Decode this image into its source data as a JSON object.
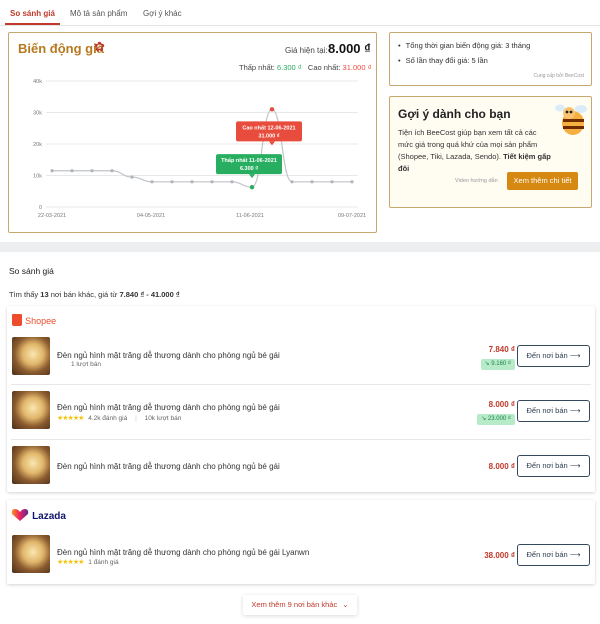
{
  "tabs": [
    {
      "label": "So sánh giá"
    },
    {
      "label": "Mô tả sản phẩm"
    },
    {
      "label": "Gợi ý khác"
    }
  ],
  "price_history": {
    "title": "Biến động giá",
    "current_label": "Giá hiện tại:",
    "current_value": "8.000 ₫",
    "min_label": "Thấp nhất:",
    "min_value": "6.300 ₫",
    "max_label": "Cao nhất:",
    "max_value": "31.000 ₫",
    "callout_high_line1": "Cao nhất 12-06-2021",
    "callout_high_line2": "31.000 ₫",
    "callout_low_line1": "Thấp nhất 11-06-2021",
    "callout_low_line2": "6.300 ₫"
  },
  "chart_data": {
    "type": "line",
    "title": "Biến động giá",
    "xlabel": "",
    "ylabel": "",
    "ylim": [
      0,
      40000
    ],
    "y_ticks": [
      "0",
      "10k",
      "20k",
      "30k",
      "40k"
    ],
    "x_ticks": [
      "22-03-2021",
      "04-05-2021",
      "11-06-2021",
      "09-07-2021"
    ],
    "series": [
      {
        "values": [
          11500,
          11500,
          11500,
          11500,
          9500,
          8000,
          8000,
          8000,
          8000,
          8000,
          6300,
          31000,
          8000,
          8000,
          8000,
          8000
        ]
      }
    ],
    "grid": true
  },
  "info": {
    "line1": "Tổng thời gian biến động giá: 3 tháng",
    "line2": "Số lần thay đổi giá: 5 lần",
    "credit": "Cung cấp bởi BeeCost"
  },
  "suggest": {
    "title": "Gợi ý dành cho bạn",
    "text": "Tiện ích BeeCost giúp bạn xem tất cả các mức giá trong quá khứ của mọi sản phẩm (Shopee, Tiki, Lazada, Sendo).",
    "text_bold": "Tiết kiệm gấp đôi",
    "video_label": "Video hướng dẫn",
    "button": "Xem thêm chi tiết"
  },
  "compare": {
    "title": "So sánh giá",
    "found_prefix": "Tìm thấy",
    "found_count": "13",
    "found_mid": "nơi bán khác, giá từ",
    "found_range": "7.840 ₫ - 41.000 ₫",
    "shops": [
      {
        "name": "Shopee",
        "color": "#ee4d2d",
        "items": [
          {
            "name": "Đèn ngủ hình mặt trăng dễ thương dành cho phòng ngủ bé gái",
            "meta": "1 lượt bán",
            "rating": "",
            "price": "7.840 ₫",
            "drop": "↘ 9.160 ₫",
            "button": "Đến nơi bán ⟶"
          },
          {
            "name": "Đèn ngủ hình mặt trăng dễ thương dành cho phòng ngủ bé gái",
            "rating": "4.2k đánh giá",
            "meta": "10k lượt bán",
            "price": "8.000 ₫",
            "drop": "↘ 23.000 ₫",
            "button": "Đến nơi bán ⟶"
          },
          {
            "name": "Đèn ngủ hình mặt trăng dễ thương dành cho phòng ngủ bé gái",
            "meta": "",
            "rating": "",
            "price": "8.000 ₫",
            "drop": "",
            "button": "Đến nơi bán ⟶"
          }
        ]
      },
      {
        "name": "Lazada",
        "color": "#0f146d",
        "items": [
          {
            "name": "Đèn ngủ hình mặt trăng dễ thương dành cho phòng ngủ bé gái Lyanwn",
            "rating": "1 đánh giá",
            "meta": "",
            "price": "38.000 ₫",
            "drop": "",
            "button": "Đến nơi bán ⟶"
          }
        ]
      }
    ],
    "more_button": "Xem thêm 9 nơi bán khác"
  },
  "colors": {
    "accent": "#c0392b",
    "gold": "#c8a86e",
    "green": "#27ae60",
    "red": "#e74c3c"
  }
}
